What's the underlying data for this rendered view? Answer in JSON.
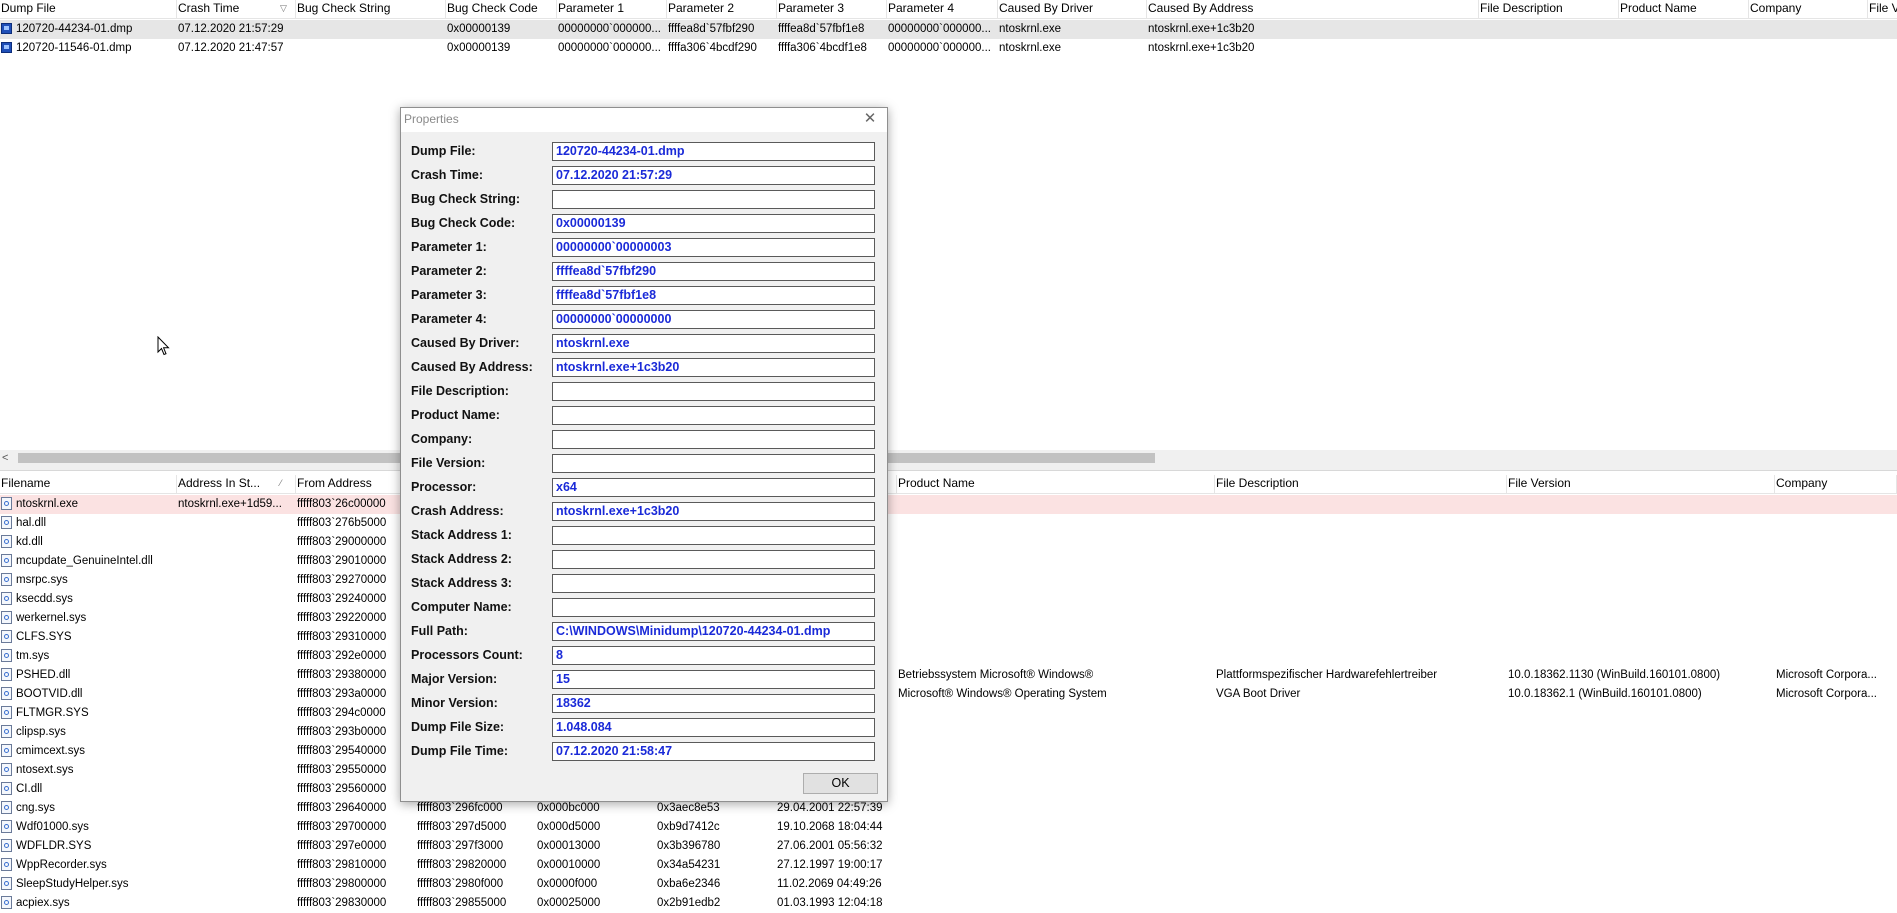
{
  "top_table": {
    "headers": [
      "Dump File",
      "Crash Time",
      "Bug Check String",
      "Bug Check Code",
      "Parameter 1",
      "Parameter 2",
      "Parameter 3",
      "Parameter 4",
      "Caused By Driver",
      "Caused By Address",
      "File Description",
      "Product Name",
      "Company",
      "File V"
    ],
    "rows": [
      [
        "120720-44234-01.dmp",
        "07.12.2020 21:57:29",
        "",
        "0x00000139",
        "00000000`000000...",
        "ffffea8d`57fbf290",
        "ffffea8d`57fbf1e8",
        "00000000`000000...",
        "ntoskrnl.exe",
        "ntoskrnl.exe+1c3b20",
        "",
        "",
        "",
        ""
      ],
      [
        "120720-11546-01.dmp",
        "07.12.2020 21:47:57",
        "",
        "0x00000139",
        "00000000`000000...",
        "ffffa306`4bcdf290",
        "ffffa306`4bcdf1e8",
        "00000000`000000...",
        "ntoskrnl.exe",
        "ntoskrnl.exe+1c3b20",
        "",
        "",
        "",
        ""
      ]
    ]
  },
  "bottom_table": {
    "headers": [
      "Filename",
      "Address In St...",
      "From Address",
      "",
      "",
      "",
      "",
      "",
      "Product Name",
      "File Description",
      "File Version",
      "Company"
    ],
    "rows": [
      [
        "ntoskrnl.exe",
        "ntoskrnl.exe+1d59...",
        "fffff803`26c00000",
        "",
        "",
        "",
        "",
        "",
        "",
        "",
        "",
        ""
      ],
      [
        "hal.dll",
        "",
        "fffff803`276b5000",
        "",
        "",
        "",
        "",
        "",
        "",
        "",
        "",
        ""
      ],
      [
        "kd.dll",
        "",
        "fffff803`29000000",
        "",
        "",
        "",
        "",
        "",
        "",
        "",
        "",
        ""
      ],
      [
        "mcupdate_GenuineIntel.dll",
        "",
        "fffff803`29010000",
        "",
        "",
        "",
        "",
        "",
        "",
        "",
        "",
        ""
      ],
      [
        "msrpc.sys",
        "",
        "fffff803`29270000",
        "",
        "",
        "",
        "",
        "",
        "",
        "",
        "",
        ""
      ],
      [
        "ksecdd.sys",
        "",
        "fffff803`29240000",
        "",
        "",
        "",
        "",
        "",
        "",
        "",
        "",
        ""
      ],
      [
        "werkernel.sys",
        "",
        "fffff803`29220000",
        "",
        "",
        "",
        "",
        "",
        "",
        "",
        "",
        ""
      ],
      [
        "CLFS.SYS",
        "",
        "fffff803`29310000",
        "",
        "",
        "",
        "",
        "",
        "",
        "",
        "",
        ""
      ],
      [
        "tm.sys",
        "",
        "fffff803`292e0000",
        "",
        "",
        "",
        "",
        "",
        "",
        "",
        "",
        ""
      ],
      [
        "PSHED.dll",
        "",
        "fffff803`29380000",
        "",
        "",
        "",
        "",
        "",
        "Betriebssystem Microsoft® Windows®",
        "Plattformspezifischer Hardwarefehlertreiber",
        "10.0.18362.1130 (WinBuild.160101.0800)",
        "Microsoft Corpora..."
      ],
      [
        "BOOTVID.dll",
        "",
        "fffff803`293a0000",
        "",
        "",
        "",
        "",
        "",
        "Microsoft® Windows® Operating System",
        "VGA Boot Driver",
        "10.0.18362.1 (WinBuild.160101.0800)",
        "Microsoft Corpora..."
      ],
      [
        "FLTMGR.SYS",
        "",
        "fffff803`294c0000",
        "",
        "",
        "",
        "",
        "",
        "",
        "",
        "",
        ""
      ],
      [
        "clipsp.sys",
        "",
        "fffff803`293b0000",
        "",
        "",
        "",
        "",
        "",
        "",
        "",
        "",
        ""
      ],
      [
        "cmimcext.sys",
        "",
        "fffff803`29540000",
        "",
        "",
        "",
        "",
        "",
        "",
        "",
        "",
        ""
      ],
      [
        "ntosext.sys",
        "",
        "fffff803`29550000",
        "",
        "",
        "",
        "",
        "",
        "",
        "",
        "",
        ""
      ],
      [
        "CI.dll",
        "",
        "fffff803`29560000",
        "",
        "",
        "",
        "",
        "",
        "",
        "",
        "",
        ""
      ],
      [
        "cng.sys",
        "",
        "fffff803`29640000",
        "fffff803`296fc000",
        "0x000bc000",
        "0x3aec8e53",
        "29.04.2001 22:57:39",
        "",
        "",
        "",
        "",
        ""
      ],
      [
        "Wdf01000.sys",
        "",
        "fffff803`29700000",
        "fffff803`297d5000",
        "0x000d5000",
        "0xb9d7412c",
        "19.10.2068 18:04:44",
        "",
        "",
        "",
        "",
        ""
      ],
      [
        "WDFLDR.SYS",
        "",
        "fffff803`297e0000",
        "fffff803`297f3000",
        "0x00013000",
        "0x3b396780",
        "27.06.2001 05:56:32",
        "",
        "",
        "",
        "",
        ""
      ],
      [
        "WppRecorder.sys",
        "",
        "fffff803`29810000",
        "fffff803`29820000",
        "0x00010000",
        "0x34a54231",
        "27.12.1997 19:00:17",
        "",
        "",
        "",
        "",
        ""
      ],
      [
        "SleepStudyHelper.sys",
        "",
        "fffff803`29800000",
        "fffff803`2980f000",
        "0x0000f000",
        "0xba6e2346",
        "11.02.2069 04:49:26",
        "",
        "",
        "",
        "",
        ""
      ],
      [
        "acpiex.sys",
        "",
        "fffff803`29830000",
        "fffff803`29855000",
        "0x00025000",
        "0x2b91edb2",
        "01.03.1993 12:04:18",
        "",
        "",
        "",
        "",
        ""
      ]
    ]
  },
  "dialog": {
    "title": "Properties",
    "close_glyph": "✕",
    "ok_label": "OK",
    "fields": [
      {
        "label": "Dump File:",
        "value": "120720-44234-01.dmp"
      },
      {
        "label": "Crash Time:",
        "value": "07.12.2020 21:57:29"
      },
      {
        "label": "Bug Check String:",
        "value": ""
      },
      {
        "label": "Bug Check Code:",
        "value": "0x00000139"
      },
      {
        "label": "Parameter 1:",
        "value": "00000000`00000003"
      },
      {
        "label": "Parameter 2:",
        "value": "ffffea8d`57fbf290"
      },
      {
        "label": "Parameter 3:",
        "value": "ffffea8d`57fbf1e8"
      },
      {
        "label": "Parameter 4:",
        "value": "00000000`00000000"
      },
      {
        "label": "Caused By Driver:",
        "value": "ntoskrnl.exe"
      },
      {
        "label": "Caused By Address:",
        "value": "ntoskrnl.exe+1c3b20"
      },
      {
        "label": "File Description:",
        "value": ""
      },
      {
        "label": "Product Name:",
        "value": ""
      },
      {
        "label": "Company:",
        "value": ""
      },
      {
        "label": "File Version:",
        "value": ""
      },
      {
        "label": "Processor:",
        "value": "x64"
      },
      {
        "label": "Crash Address:",
        "value": "ntoskrnl.exe+1c3b20"
      },
      {
        "label": "Stack Address 1:",
        "value": ""
      },
      {
        "label": "Stack Address 2:",
        "value": ""
      },
      {
        "label": "Stack Address 3:",
        "value": ""
      },
      {
        "label": "Computer Name:",
        "value": ""
      },
      {
        "label": "Full Path:",
        "value": "C:\\WINDOWS\\Minidump\\120720-44234-01.dmp"
      },
      {
        "label": "Processors Count:",
        "value": "8"
      },
      {
        "label": "Major Version:",
        "value": "15"
      },
      {
        "label": "Minor Version:",
        "value": "18362"
      },
      {
        "label": "Dump File Size:",
        "value": "1.048.084"
      },
      {
        "label": "Dump File Time:",
        "value": "07.12.2020 21:58:47"
      }
    ]
  },
  "scrollbar": {
    "left_arrow": "<"
  },
  "icons": {
    "dump_file": "dump-file-icon",
    "module": "module-file-icon",
    "cursor": "mouse-pointer-icon"
  },
  "colors": {
    "dialog_value_text": "#1a2ad8",
    "selected_row": "#e6e6e6",
    "highlight_row": "#fbe2e2"
  }
}
